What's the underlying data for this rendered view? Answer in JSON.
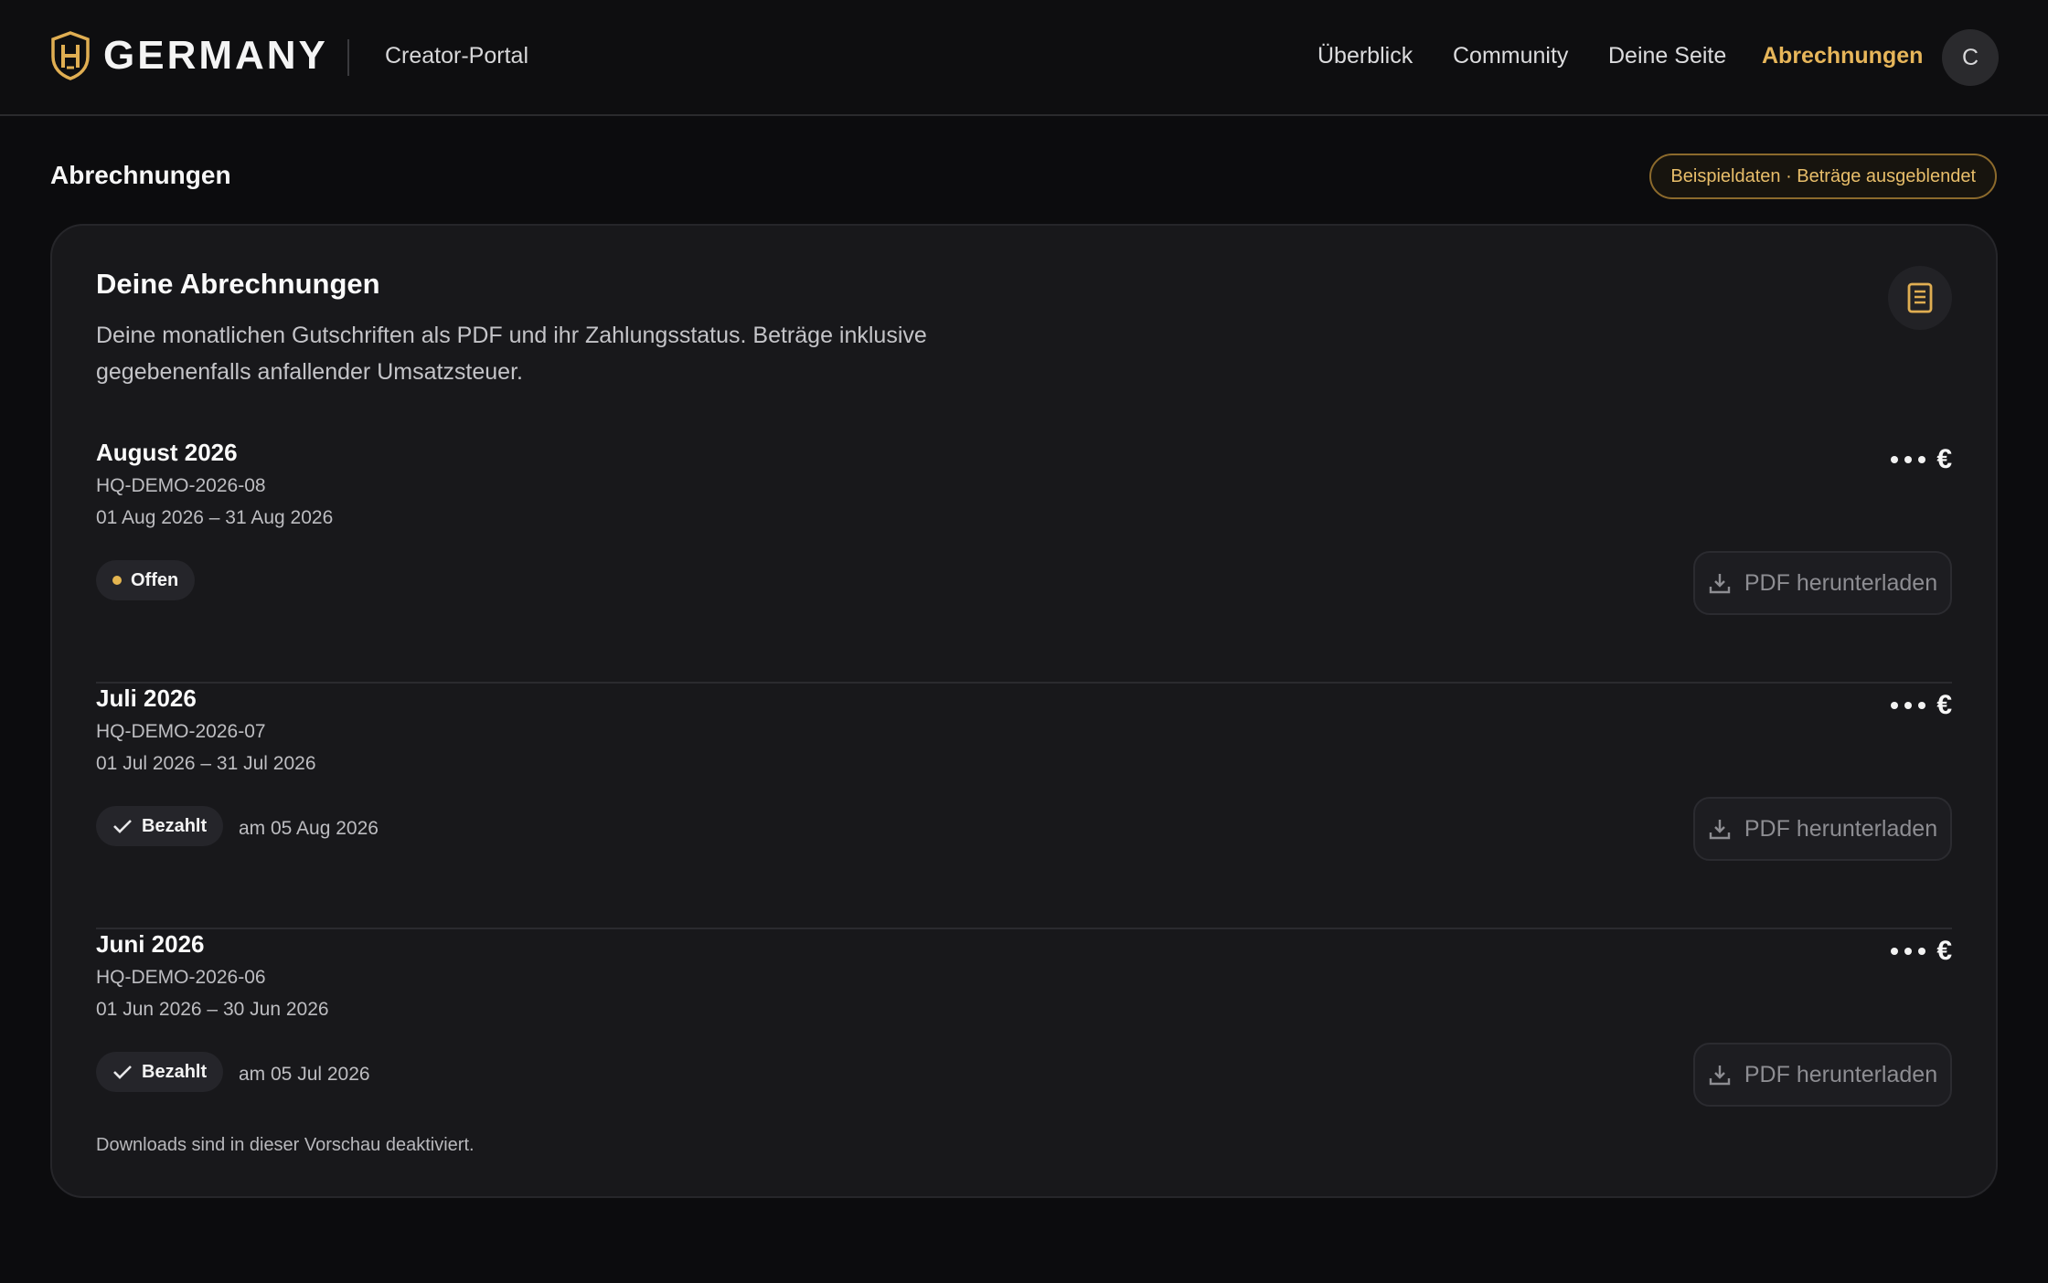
{
  "header": {
    "brand_name": "GERMANY",
    "brand_sub": "Creator-Portal",
    "nav": [
      {
        "label": "Überblick",
        "active": false
      },
      {
        "label": "Community",
        "active": false
      },
      {
        "label": "Deine Seite",
        "active": false
      },
      {
        "label": "Abrechnungen",
        "active": true
      }
    ],
    "avatar_initial": "C"
  },
  "page": {
    "title": "Abrechnungen",
    "demo_badge": "Beispieldaten · Beträge ausgeblendet"
  },
  "card": {
    "title": "Deine Abrechnungen",
    "description": "Deine monatlichen Gutschriften als PDF und ihr Zahlungsstatus. Beträge inklusive gegebenenfalls anfallender Umsatzsteuer.",
    "icon": "document-list-icon",
    "currency_symbol": "€",
    "pdf_label": "PDF herunterladen",
    "statements": [
      {
        "month": "August 2026",
        "id": "HQ-DEMO-2026-08",
        "period": "01 Aug 2026 – 31 Aug 2026",
        "status": "Offen",
        "status_type": "open",
        "paid_date": ""
      },
      {
        "month": "Juli 2026",
        "id": "HQ-DEMO-2026-07",
        "period": "01 Jul 2026 – 31 Jul 2026",
        "status": "Bezahlt",
        "status_type": "paid",
        "paid_date": "am 05 Aug 2026"
      },
      {
        "month": "Juni 2026",
        "id": "HQ-DEMO-2026-06",
        "period": "01 Jun 2026 – 30 Jun 2026",
        "status": "Bezahlt",
        "status_type": "paid",
        "paid_date": "am 05 Jul 2026"
      }
    ],
    "footnote": "Downloads sind in dieser Vorschau deaktiviert."
  },
  "colors": {
    "accent": "#e7b65a",
    "background": "#0c0c0e",
    "card": "#18181b"
  }
}
